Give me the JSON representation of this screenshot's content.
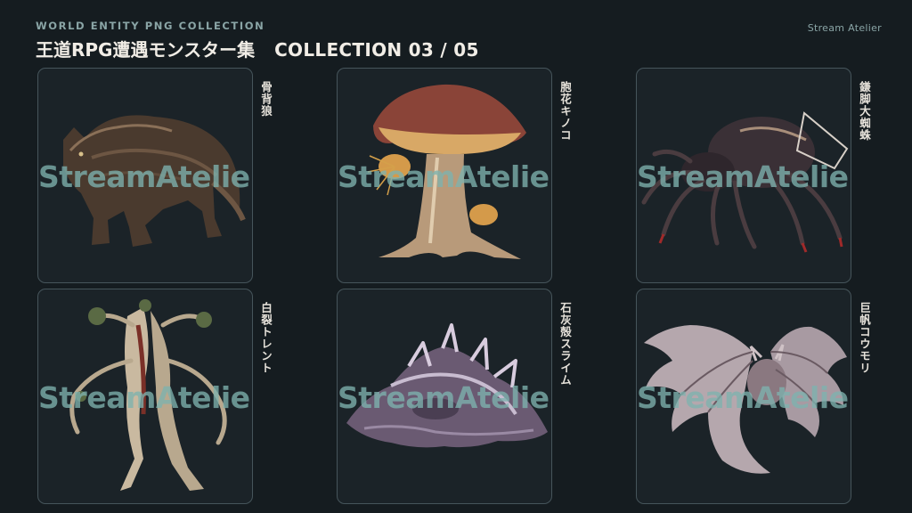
{
  "header": {
    "kicker": "WORLD ENTITY PNG COLLECTION",
    "title": "王道RPG遭遇モンスター集",
    "collection": "COLLECTION 03 / 05",
    "brand": "Stream Atelier"
  },
  "watermark": "StreamAtelier",
  "cards": [
    {
      "name": "骨背狼",
      "icon": "wolf-icon"
    },
    {
      "name": "胞花キノコ",
      "icon": "mushroom-icon"
    },
    {
      "name": "鎌脚大蜘蛛",
      "icon": "spider-icon"
    },
    {
      "name": "白裂トレント",
      "icon": "treant-icon"
    },
    {
      "name": "石灰殻スライム",
      "icon": "slime-icon"
    },
    {
      "name": "巨帆コウモリ",
      "icon": "bat-icon"
    }
  ]
}
